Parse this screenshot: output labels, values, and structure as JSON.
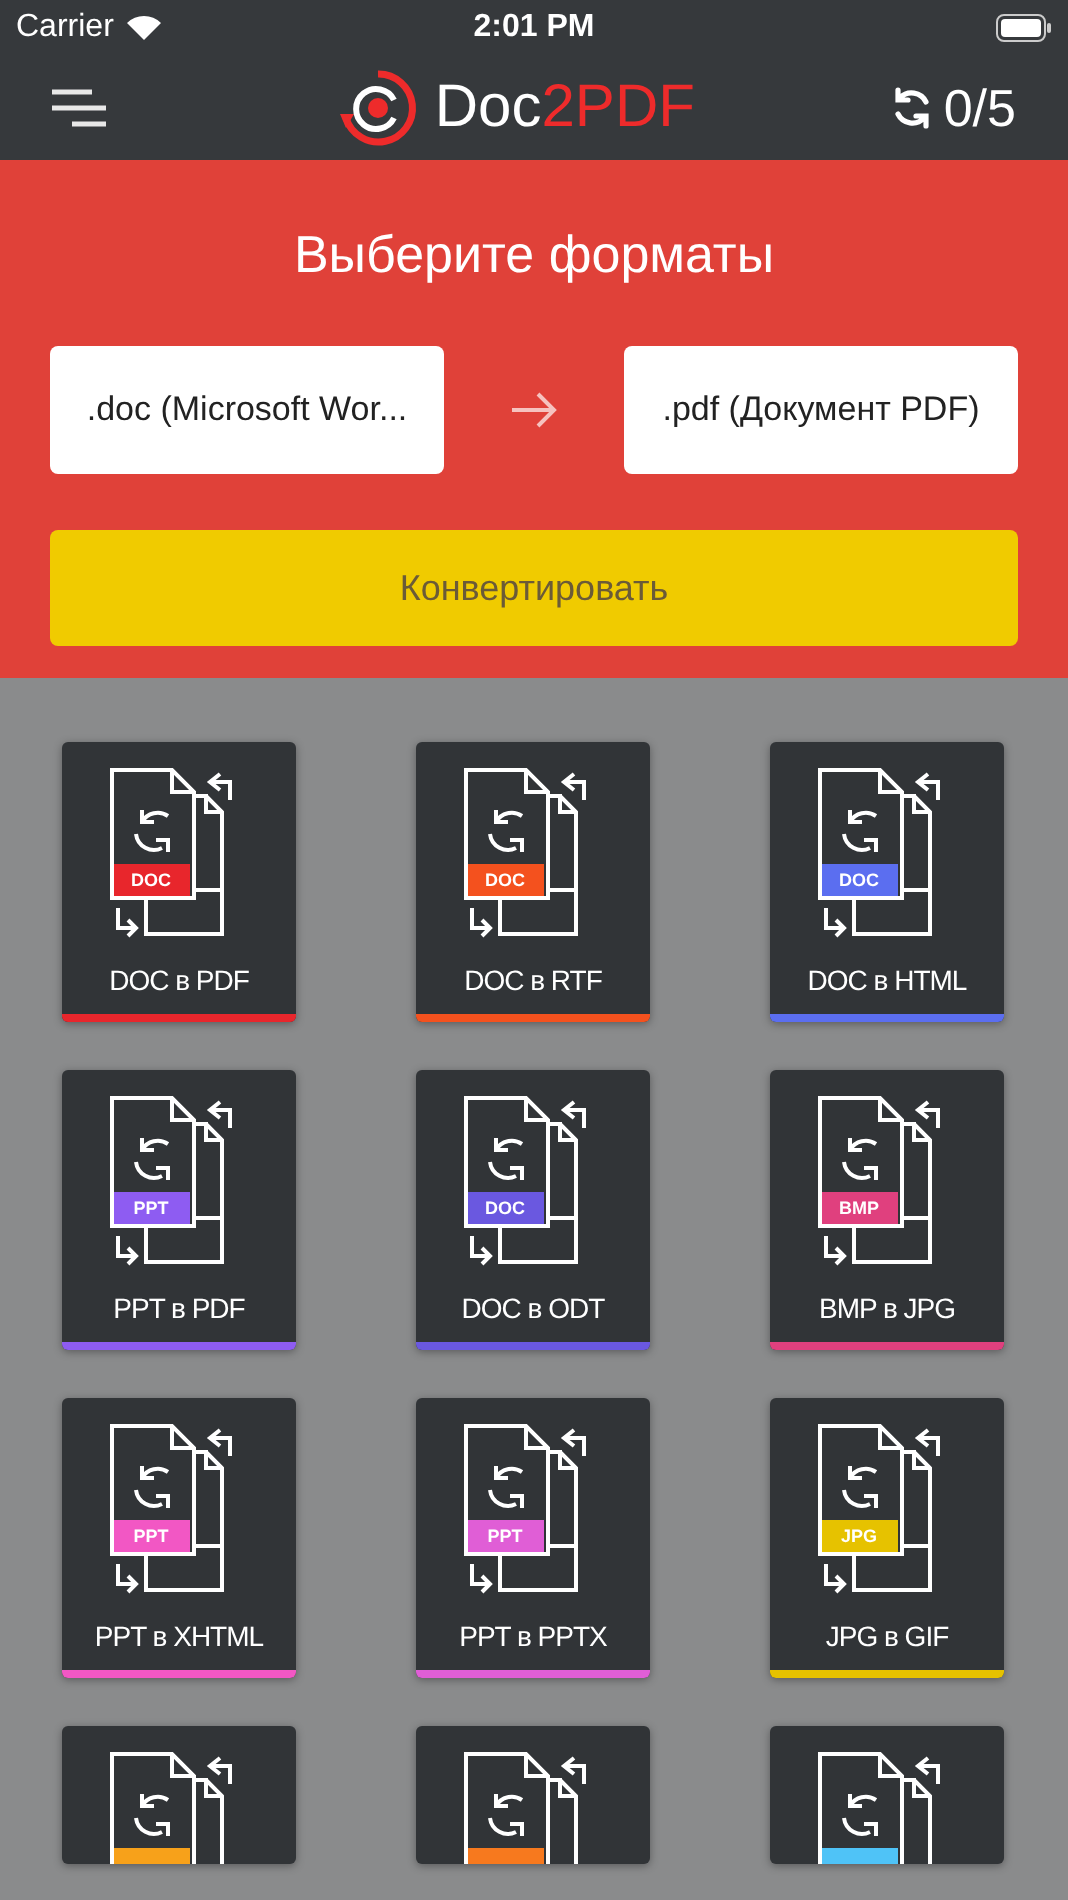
{
  "status_bar": {
    "carrier": "Carrier",
    "time": "2:01 PM"
  },
  "nav": {
    "brand": "Doc",
    "brand_accent": "2PDF",
    "counter": "0/5"
  },
  "converter": {
    "title": "Выберите форматы",
    "from": ".doc (Microsoft Wor...",
    "to": ".pdf (Документ PDF)",
    "button": "Конвертировать"
  },
  "cards": [
    {
      "badge": "DOC",
      "title": "DOC в PDF",
      "color": "#e8262c"
    },
    {
      "badge": "DOC",
      "title": "DOC в RTF",
      "color": "#f4511e"
    },
    {
      "badge": "DOC",
      "title": "DOC в HTML",
      "color": "#5b6ef0"
    },
    {
      "badge": "PPT",
      "title": "PPT в PDF",
      "color": "#8e5cf2"
    },
    {
      "badge": "DOC",
      "title": "DOC в ODT",
      "color": "#6a58e0"
    },
    {
      "badge": "BMP",
      "title": "BMP в JPG",
      "color": "#e0407e"
    },
    {
      "badge": "PPT",
      "title": "PPT в XHTML",
      "color": "#f257c4"
    },
    {
      "badge": "PPT",
      "title": "PPT в PPTX",
      "color": "#e05ed6"
    },
    {
      "badge": "JPG",
      "title": "JPG в GIF",
      "color": "#e6c200"
    },
    {
      "color": "#f7a11a"
    },
    {
      "color": "#f7791e"
    },
    {
      "color": "#4fc3f7"
    }
  ]
}
